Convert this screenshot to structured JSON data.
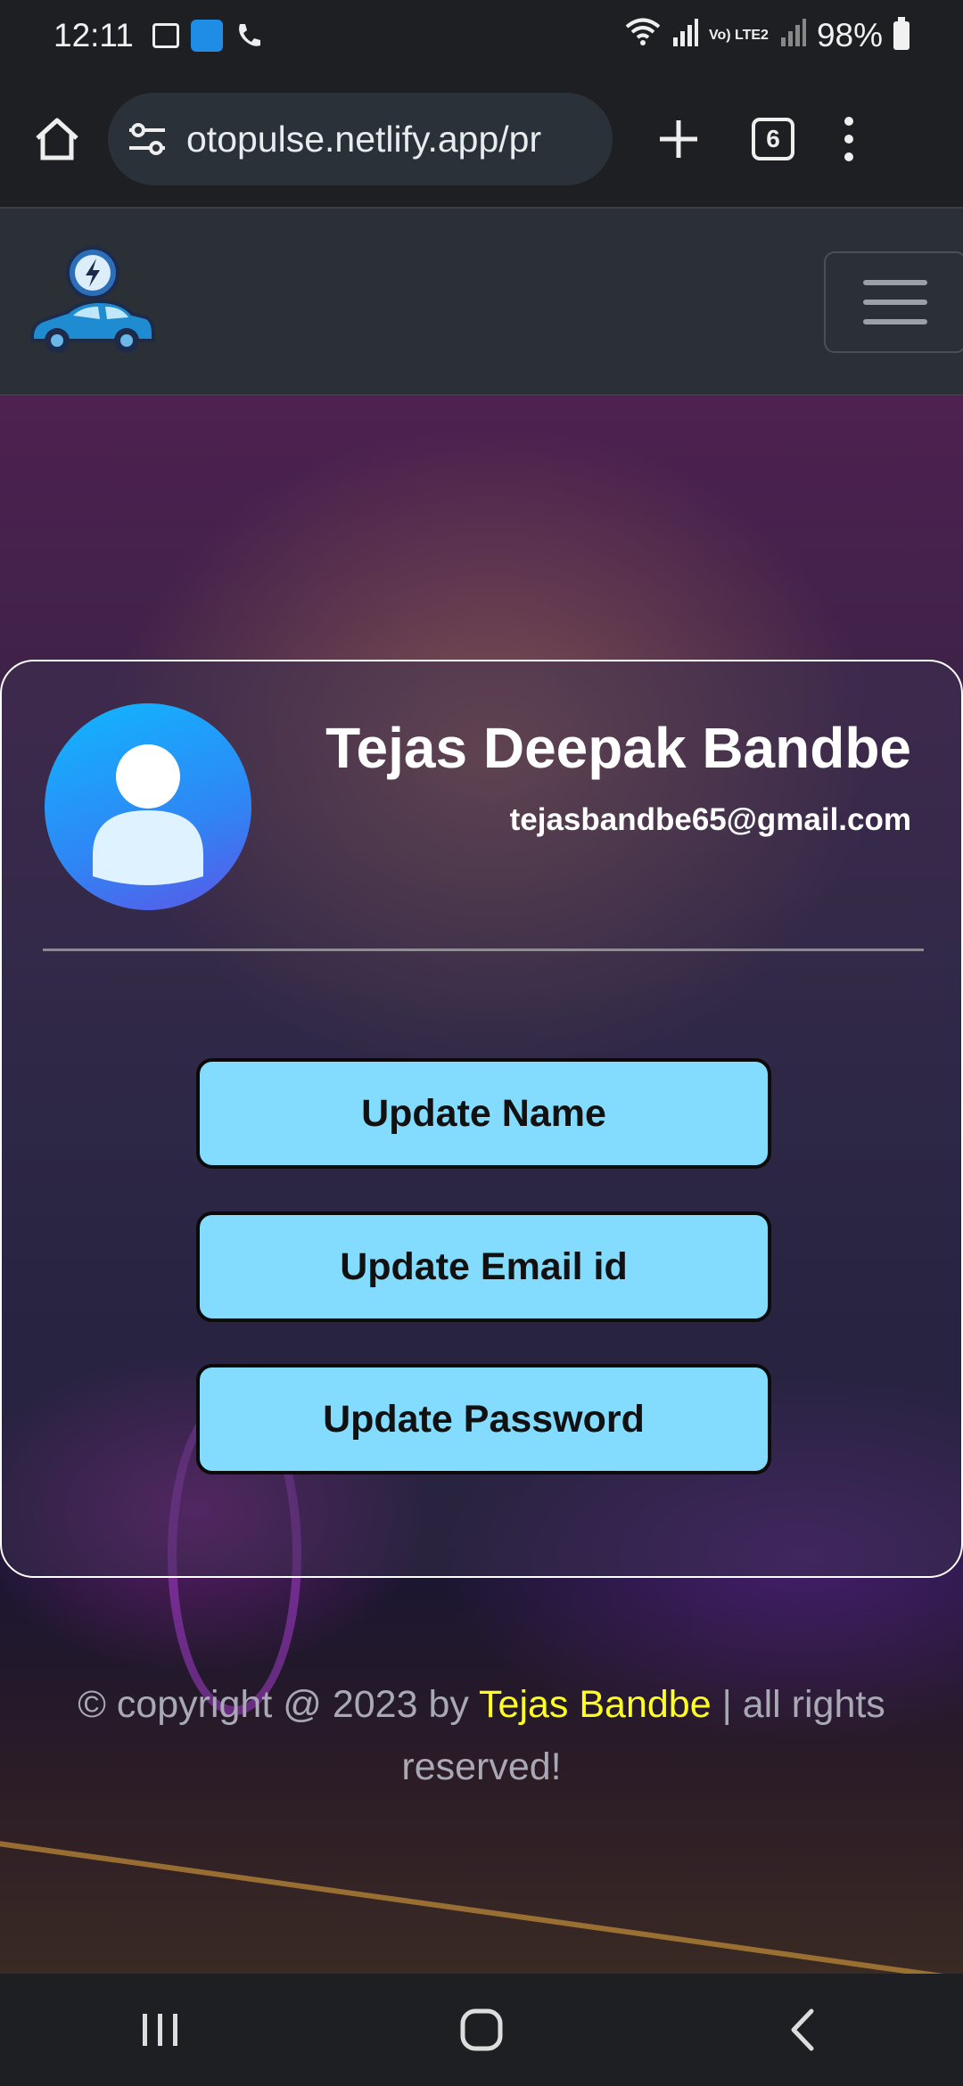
{
  "status_bar": {
    "time": "12:11",
    "lte_label": "Vo) LTE2",
    "battery": "98%"
  },
  "browser": {
    "url": "otopulse.netlify.app/pr",
    "tab_count": "6"
  },
  "profile": {
    "name": "Tejas Deepak Bandbe",
    "email": "tejasbandbe65@gmail.com"
  },
  "actions": {
    "update_name": "Update Name",
    "update_email": "Update Email id",
    "update_password": "Update Password"
  },
  "footer": {
    "prefix": "© copyright @ 2023 by ",
    "author": "Tejas Bandbe",
    "suffix": " | all rights reserved!"
  },
  "colors": {
    "button_bg": "#83dcfe",
    "author_highlight": "#ffff22",
    "avatar_gradient_start": "#10b7ff"
  },
  "icons": [
    "home-icon",
    "site-settings-icon",
    "new-tab-icon",
    "tab-switcher-icon",
    "menu-icon",
    "hamburger-icon",
    "recent-apps-icon",
    "home-nav-icon",
    "back-icon"
  ]
}
